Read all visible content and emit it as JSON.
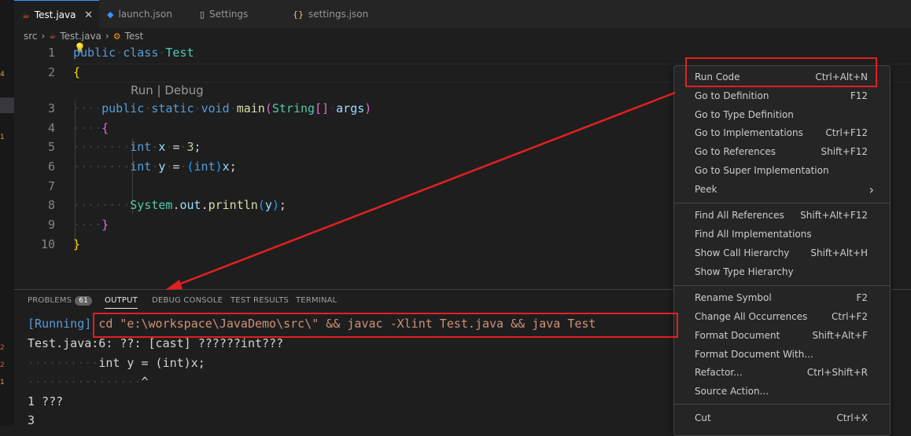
{
  "tabs": [
    {
      "label": "Test.java",
      "icon": "java-icon",
      "active": true
    },
    {
      "label": "launch.json",
      "icon": "vscode-icon"
    },
    {
      "label": "Settings",
      "icon": "file-icon"
    },
    {
      "label": "settings.json",
      "icon": "braces-icon"
    }
  ],
  "tab_close_glyph": "✕",
  "breadcrumb": {
    "folder": "src",
    "file": "Test.java",
    "symbol": "Test"
  },
  "editor": {
    "line_numbers": [
      "1",
      "2",
      "3",
      "4",
      "5",
      "6",
      "7",
      "8",
      "9",
      "10"
    ],
    "codelens": "Run | Debug"
  },
  "panel": {
    "tabs": [
      "PROBLEMS",
      "OUTPUT",
      "DEBUG CONSOLE",
      "TEST RESULTS",
      "TERMINAL"
    ],
    "problems_count": "61",
    "active_tab": "OUTPUT",
    "output": {
      "running_tag": "[Running]",
      "command": "cd \"e:\\workspace\\JavaDemo\\src\\\" && javac -Xlint Test.java && java Test",
      "warning_line": "Test.java:6: ??: [cast] ??????int???",
      "source_echo": "int y = (int)x;",
      "caret": "^",
      "count_line": "1 ???",
      "result": "3"
    }
  },
  "context_menu": {
    "groups": [
      [
        {
          "label": "Run Code",
          "shortcut": "Ctrl+Alt+N"
        },
        {
          "label": "Go to Definition",
          "shortcut": "F12"
        },
        {
          "label": "Go to Type Definition",
          "shortcut": ""
        },
        {
          "label": "Go to Implementations",
          "shortcut": "Ctrl+F12"
        },
        {
          "label": "Go to References",
          "shortcut": "Shift+F12"
        },
        {
          "label": "Go to Super Implementation",
          "shortcut": ""
        },
        {
          "label": "Peek",
          "shortcut": "›"
        }
      ],
      [
        {
          "label": "Find All References",
          "shortcut": "Shift+Alt+F12"
        },
        {
          "label": "Find All Implementations",
          "shortcut": ""
        },
        {
          "label": "Show Call Hierarchy",
          "shortcut": "Shift+Alt+H"
        },
        {
          "label": "Show Type Hierarchy",
          "shortcut": ""
        }
      ],
      [
        {
          "label": "Rename Symbol",
          "shortcut": "F2"
        },
        {
          "label": "Change All Occurrences",
          "shortcut": "Ctrl+F2"
        },
        {
          "label": "Format Document",
          "shortcut": "Shift+Alt+F"
        },
        {
          "label": "Format Document With...",
          "shortcut": ""
        },
        {
          "label": "Refactor...",
          "shortcut": "Ctrl+Shift+R"
        },
        {
          "label": "Source Action...",
          "shortcut": ""
        }
      ],
      [
        {
          "label": "Cut",
          "shortcut": "Ctrl+X"
        }
      ]
    ]
  },
  "colors": {
    "annotation": "#e02020",
    "accent": "#3794ff"
  }
}
